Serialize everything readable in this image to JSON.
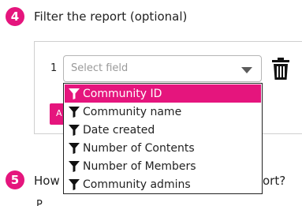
{
  "step4": {
    "number": "4",
    "title": "Filter the report (optional)"
  },
  "filter": {
    "row_number": "1",
    "select": {
      "placeholder": "Select field"
    },
    "add_button_label": "A"
  },
  "dropdown": {
    "options": [
      {
        "label": "Community ID",
        "selected": true
      },
      {
        "label": "Community name",
        "selected": false
      },
      {
        "label": "Date created",
        "selected": false
      },
      {
        "label": "Number of Contents",
        "selected": false
      },
      {
        "label": "Number of Members",
        "selected": false
      },
      {
        "label": "Community admins",
        "selected": false
      }
    ]
  },
  "step5": {
    "number": "5",
    "title_start": "How",
    "title_end": "ort?"
  },
  "below_text": "P",
  "colors": {
    "accent": "#e5157d",
    "text": "#222222",
    "placeholder": "#9a9a9a"
  },
  "icons": {
    "filter": "filter-funnel-icon",
    "delete": "trash-icon",
    "dropdown": "chevron-down-icon"
  }
}
